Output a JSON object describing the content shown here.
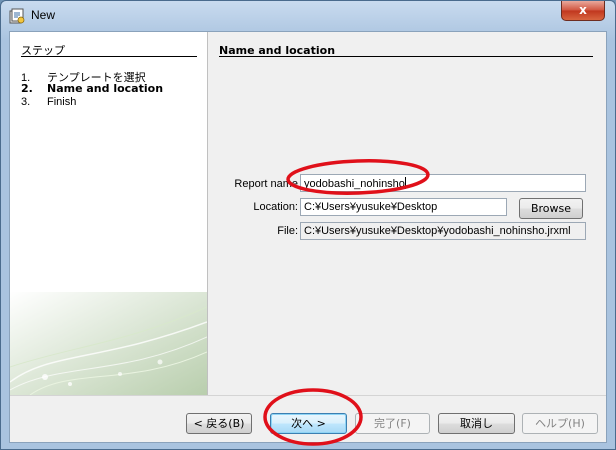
{
  "window": {
    "title": "New",
    "close_glyph": "x"
  },
  "sidebar": {
    "heading": "ステップ",
    "steps": [
      {
        "num": "1.",
        "label": "テンプレートを選択"
      },
      {
        "num": "2.",
        "label": "Name and location",
        "current": true
      },
      {
        "num": "3.",
        "label": "Finish"
      }
    ]
  },
  "main": {
    "section_title": "Name and location",
    "report_name": {
      "label": "Report name",
      "value": "yodobashi_nohinsho"
    },
    "location": {
      "label": "Location:",
      "value": "C:¥Users¥yusuke¥Desktop",
      "browse_label": "Browse"
    },
    "file": {
      "label": "File:",
      "value": "C:¥Users¥yusuke¥Desktop¥yodobashi_nohinsho.jrxml"
    }
  },
  "footer": {
    "back_label": "< 戻る(B)",
    "next_label": "次へ >",
    "finish_label": "完了(F)",
    "cancel_label": "取消し",
    "help_label": "ヘルプ(H)"
  },
  "annotation_color": "#e0101a",
  "icons": {
    "app": "wizard-app-icon",
    "close": "close-icon"
  }
}
